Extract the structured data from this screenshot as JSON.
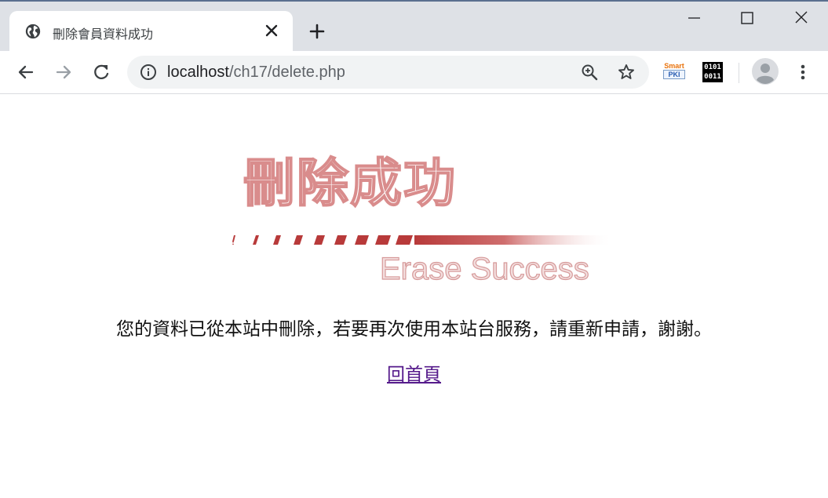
{
  "browser": {
    "tab": {
      "title": "刪除會員資料成功",
      "favicon": "globe-icon"
    },
    "address": {
      "host": "localhost",
      "path": "/ch17/delete.php"
    },
    "extensions": [
      {
        "name": "smart-pki",
        "line1": "Smart",
        "line2": "PKI"
      },
      {
        "name": "binary",
        "line1": "0101",
        "line2": "0011"
      }
    ]
  },
  "page": {
    "banner": {
      "title": "刪除成功",
      "subtitle": "Erase Success"
    },
    "message": "您的資料已從本站中刪除，若要再次使用本站台服務，請重新申請，謝謝。",
    "home_link": "回首頁"
  },
  "colors": {
    "banner_red": "#c0392b",
    "banner_pink": "#e8b4b4",
    "link_visited": "#551a8b"
  }
}
